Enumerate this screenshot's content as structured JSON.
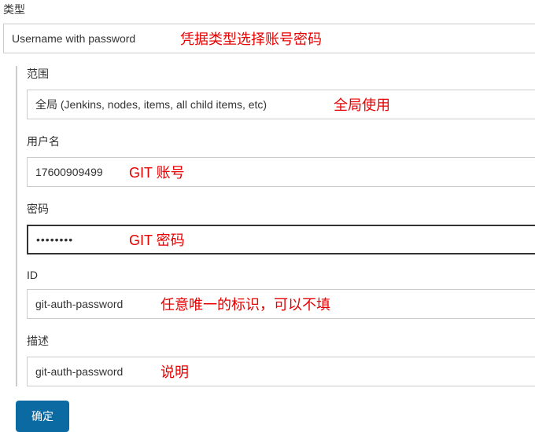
{
  "type": {
    "label": "类型",
    "value": "Username with password",
    "annotation": "凭据类型选择账号密码"
  },
  "scope": {
    "label": "范围",
    "value": "全局 (Jenkins, nodes, items, all child items, etc)",
    "annotation": "全局使用"
  },
  "username": {
    "label": "用户名",
    "value": "17600909499",
    "annotation": "GIT 账号"
  },
  "password": {
    "label": "密码",
    "value": "••••••••",
    "annotation": "GIT 密码"
  },
  "id": {
    "label": "ID",
    "value": "git-auth-password",
    "annotation": "任意唯一的标识，可以不填"
  },
  "description": {
    "label": "描述",
    "value": "git-auth-password",
    "annotation": "说明"
  },
  "buttons": {
    "ok": "确定"
  }
}
